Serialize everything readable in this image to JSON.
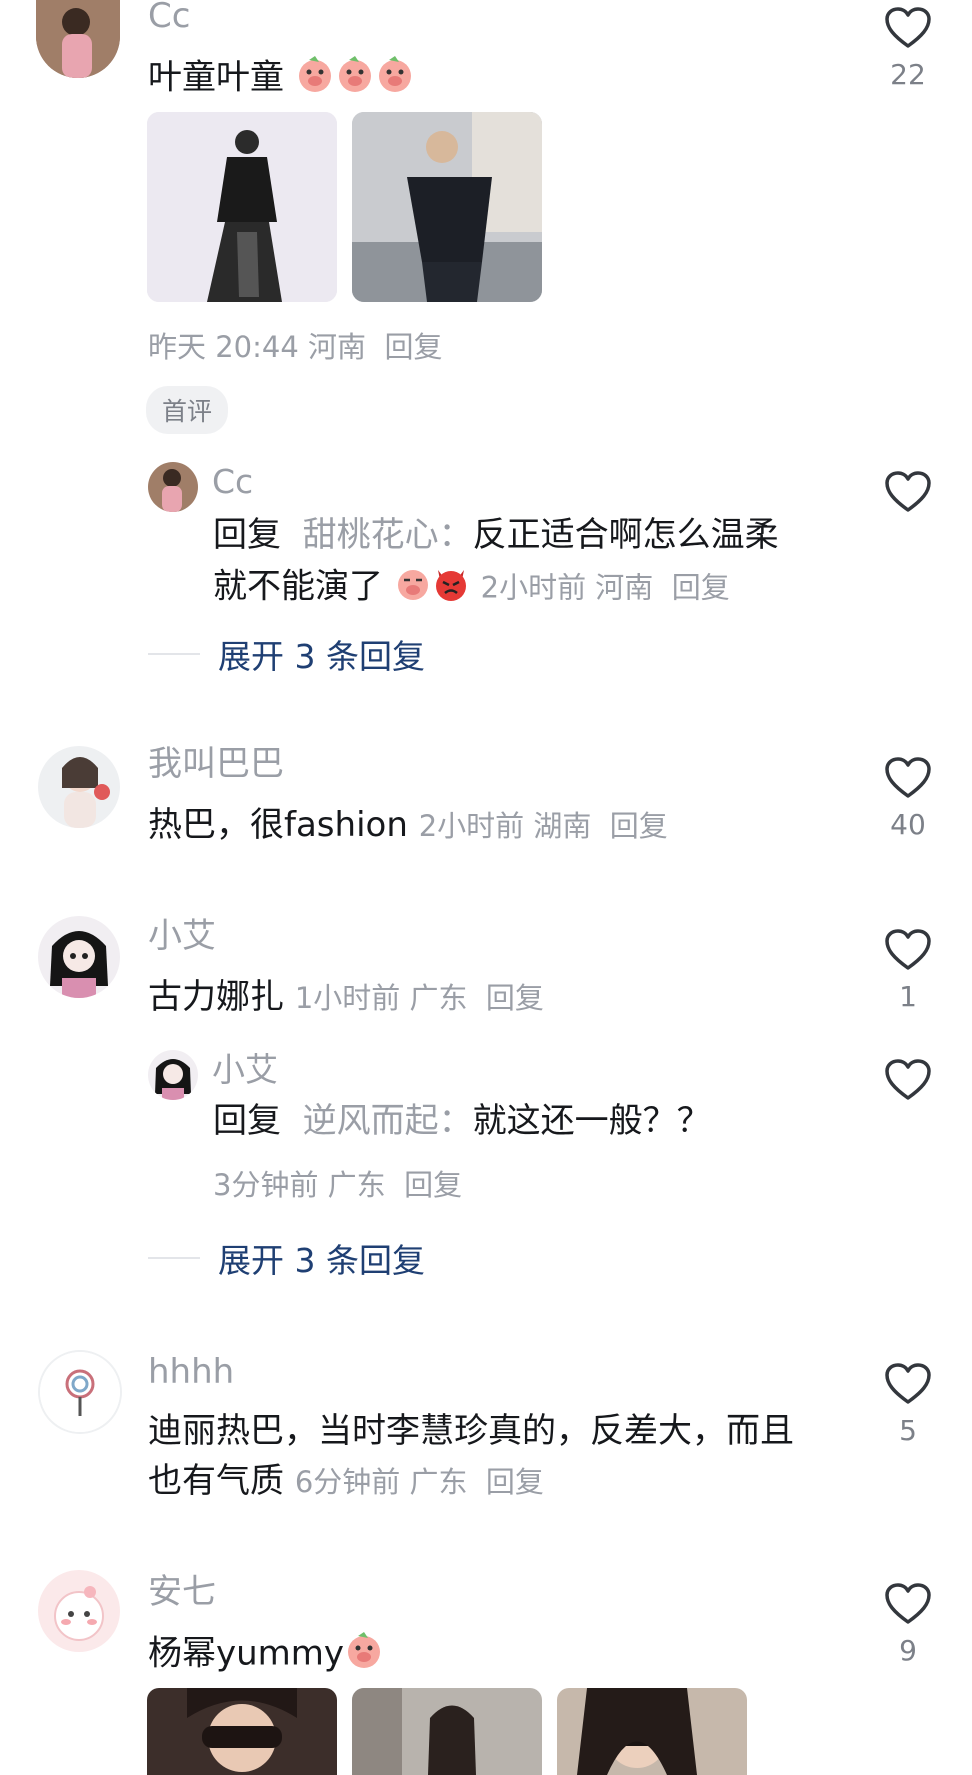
{
  "comments": [
    {
      "user": "Cc",
      "text": "叶童叶童",
      "meta": "昨天 20:44 河南  回复",
      "likes": "22",
      "badge": "首评",
      "reply": {
        "user": "Cc",
        "prefix": "回复",
        "target": "甜桃花心：",
        "text1": "反正适合啊怎么温柔",
        "text2": "就不能演了",
        "meta": "2小时前 河南  回复"
      },
      "expand": "展开 3 条回复"
    },
    {
      "user": "我叫巴巴",
      "text": "热巴，很fashion",
      "meta": "2小时前 湖南  回复",
      "likes": "40"
    },
    {
      "user": "小艾",
      "text": "古力娜扎",
      "meta": "1小时前 广东  回复",
      "likes": "1",
      "reply": {
        "user": "小艾",
        "prefix": "回复",
        "target": "逆风而起：",
        "text1": "就这还一般？？",
        "meta": "3分钟前 广东  回复"
      },
      "expand": "展开 3 条回复"
    },
    {
      "user": "hhhh",
      "text1": "迪丽热巴，当时李慧珍真的，反差大，而且",
      "text2": "也有气质",
      "meta": "6分钟前 广东  回复",
      "likes": "5"
    },
    {
      "user": "安七",
      "text": "杨幂yummy",
      "likes": "9"
    }
  ],
  "colors": {
    "primary_text": "#16181c",
    "secondary_text": "#9a9ea6",
    "expand_link": "#1f3f73",
    "badge_bg": "#f0f1f3"
  },
  "icons": [
    "heart-outline-icon",
    "pig-emoji-icon",
    "devil-emoji-icon",
    "lollipop-icon"
  ]
}
